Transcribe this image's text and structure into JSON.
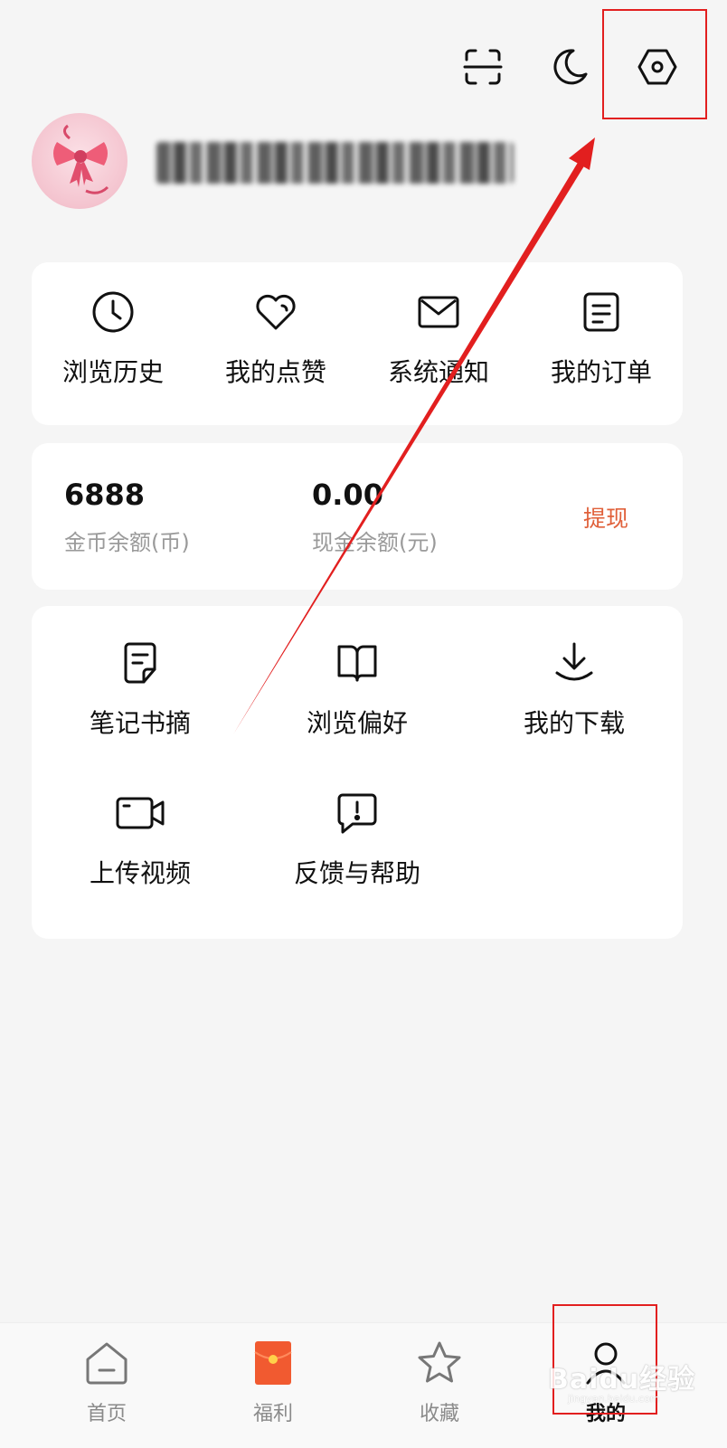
{
  "toolbar": {
    "scan_icon": "scan-icon",
    "night_icon": "moon-icon",
    "settings_icon": "settings-hexagon-icon"
  },
  "profile": {
    "avatar_icon": "bow-avatar"
  },
  "quick_links": [
    {
      "label": "浏览历史",
      "icon": "clock-icon"
    },
    {
      "label": "我的点赞",
      "icon": "heart-icon"
    },
    {
      "label": "系统通知",
      "icon": "mail-icon"
    },
    {
      "label": "我的订单",
      "icon": "order-icon"
    }
  ],
  "balance": {
    "coins_value": "6888",
    "coins_label": "金币余额(币)",
    "cash_value": "0.00",
    "cash_label": "现金余额(元)",
    "withdraw_label": "提现",
    "withdraw_color": "#e0603a"
  },
  "tools": [
    {
      "label": "笔记书摘",
      "icon": "note-icon"
    },
    {
      "label": "浏览偏好",
      "icon": "book-icon"
    },
    {
      "label": "我的下载",
      "icon": "download-icon"
    },
    {
      "label": "上传视频",
      "icon": "video-camera-icon"
    },
    {
      "label": "反馈与帮助",
      "icon": "feedback-icon"
    }
  ],
  "tabbar": [
    {
      "label": "首页",
      "icon": "home-icon",
      "active": false
    },
    {
      "label": "福利",
      "icon": "red-envelope-icon",
      "active": false
    },
    {
      "label": "收藏",
      "icon": "star-icon",
      "active": false
    },
    {
      "label": "我的",
      "icon": "person-icon",
      "active": true
    }
  ],
  "watermark": {
    "text": "Baidu经验",
    "sub": "jingyan.baidu.com"
  },
  "colors": {
    "annotation_red": "#e21f1f",
    "background": "#f5f5f5",
    "card": "#ffffff"
  }
}
